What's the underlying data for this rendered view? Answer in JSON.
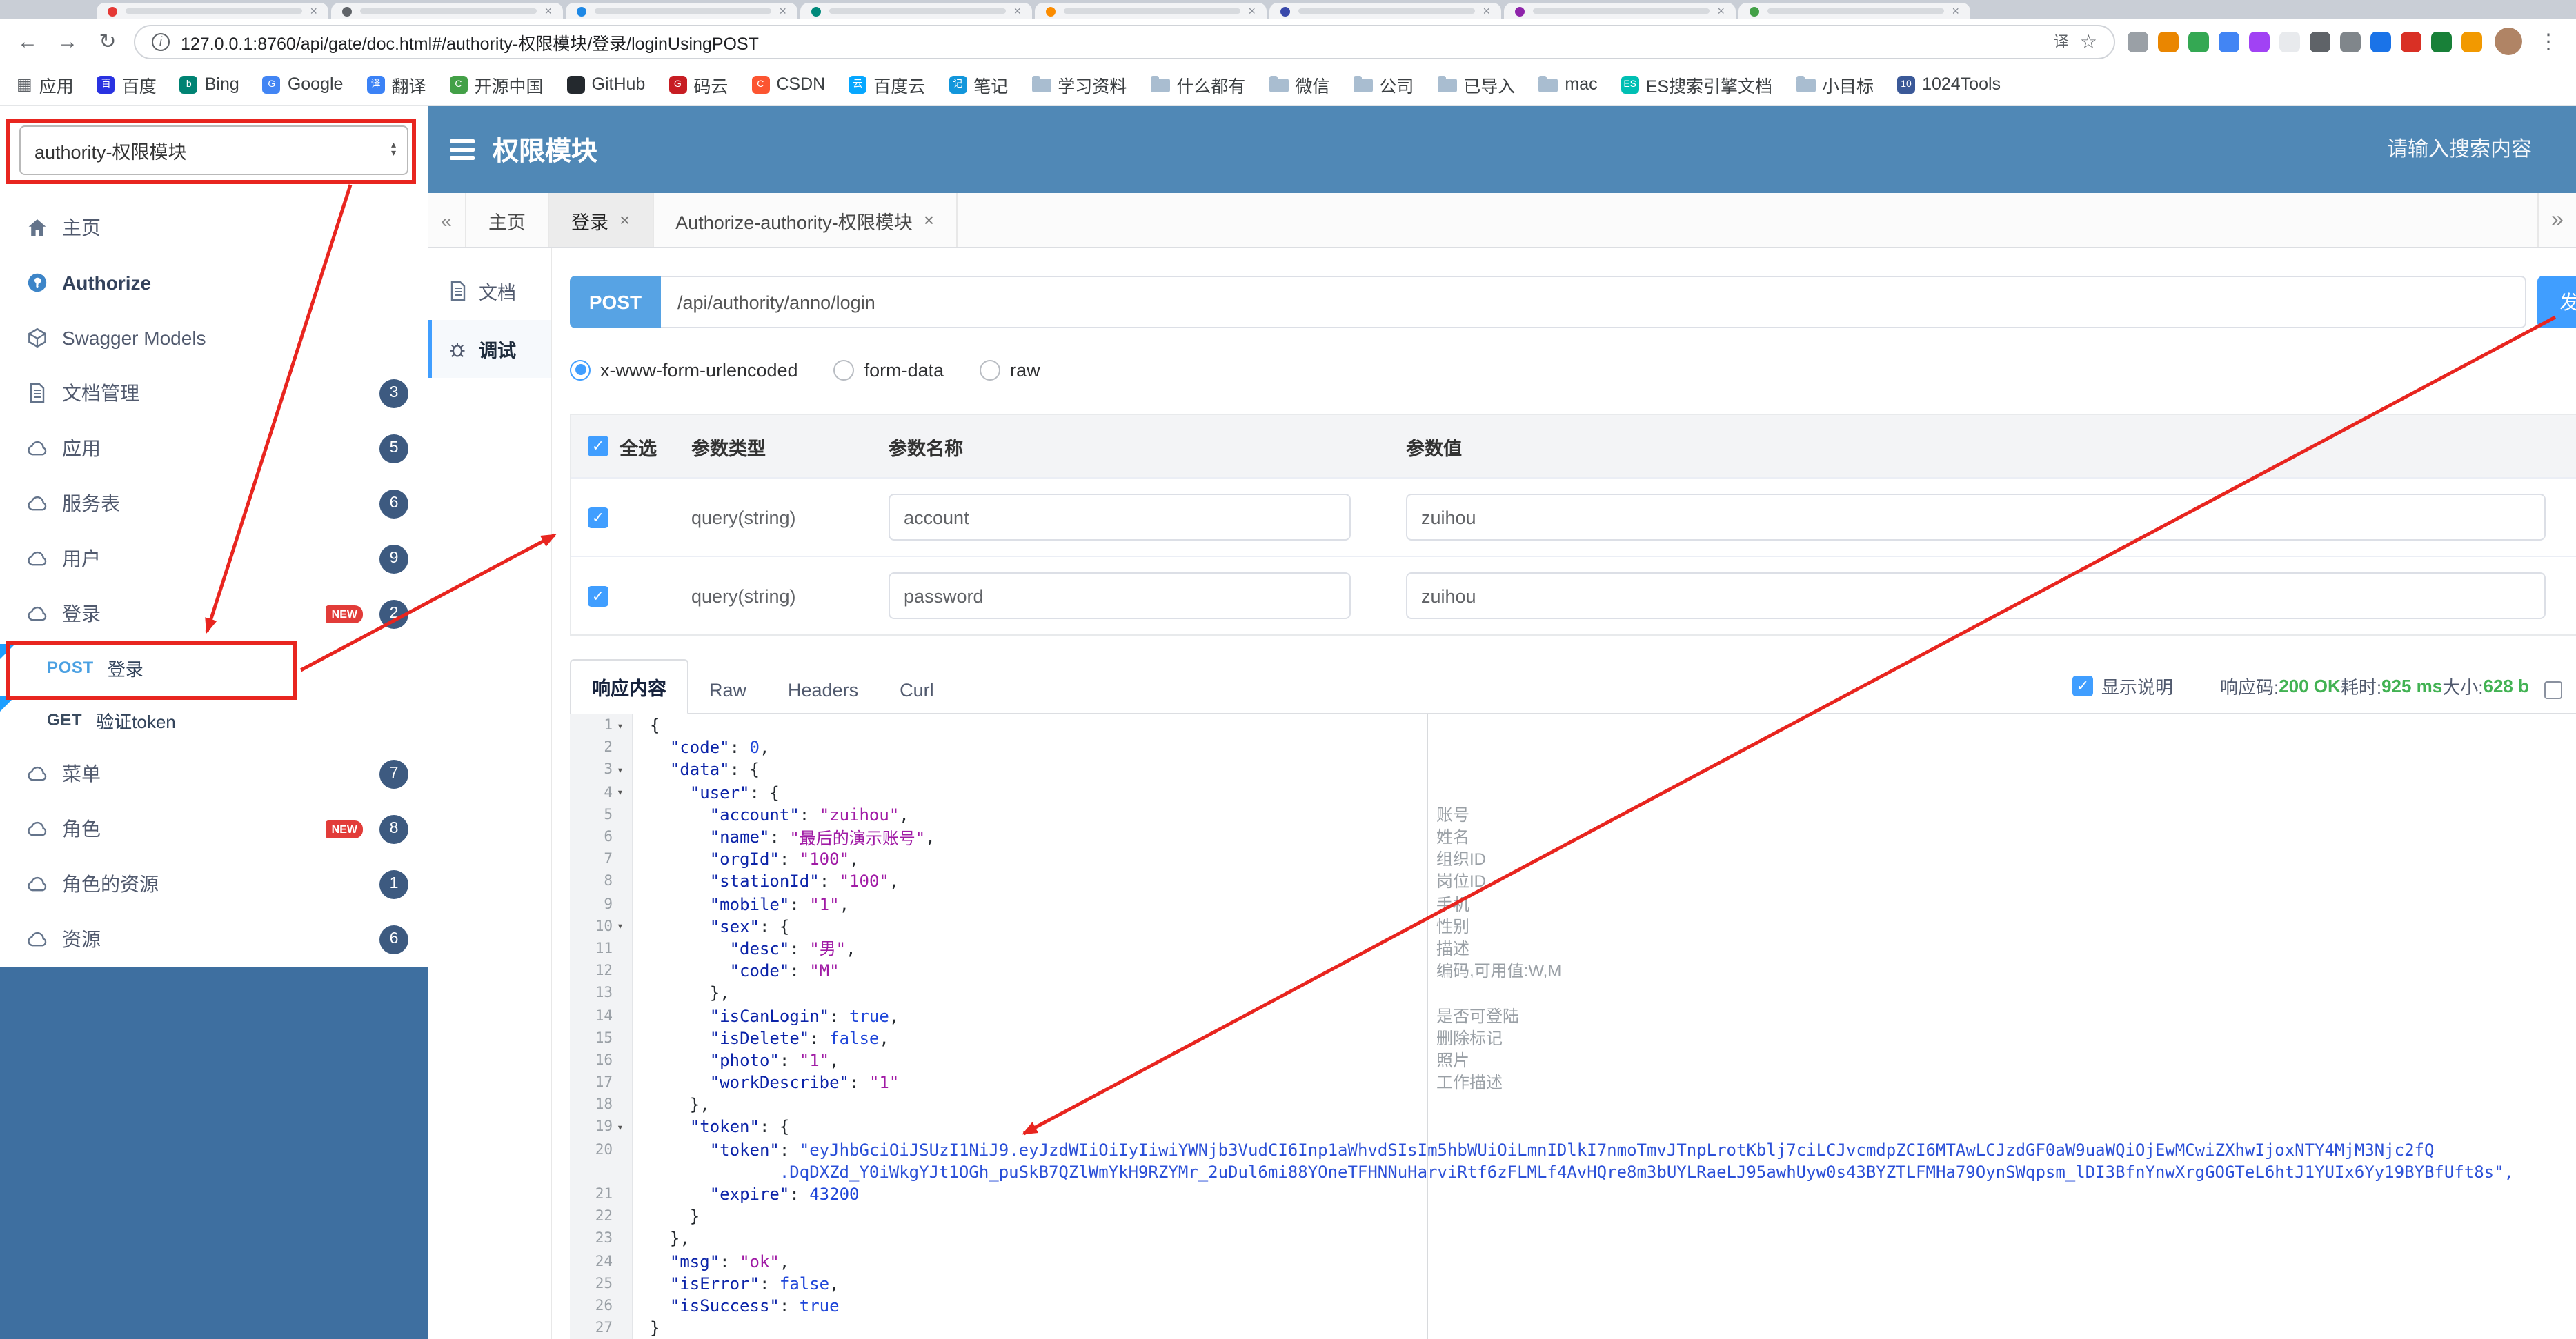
{
  "colors": {
    "accent_red": "#e8251f",
    "header_blue": "#5088b6",
    "primary_blue": "#409eff",
    "method_blue": "#57a3e4",
    "badge_navy": "#3d5a80",
    "success_green": "#42b253"
  },
  "browser": {
    "url": "127.0.0.1:8760/api/gate/doc.html#/authority-权限模块/登录/loginUsingPOST",
    "tab_strip": {
      "favicons": [
        "#e53935",
        "#5f6368",
        "#1e88e5",
        "#00897b",
        "#fb8c00",
        "#3949ab",
        "#8e24aa",
        "#43a047"
      ]
    },
    "extensions": [
      "#9aa0a6",
      "#ea8600",
      "#34a853",
      "#4285f4",
      "#a142f4",
      "#e8eaed",
      "#5f6368",
      "#80868b",
      "#1a73e8",
      "#d93025",
      "#188038",
      "#f29900"
    ],
    "bookmarks": [
      {
        "label": "应用",
        "icon": "grid"
      },
      {
        "label": "百度",
        "icon": "dot",
        "color": "#2932e1",
        "glyph": "百"
      },
      {
        "label": "Bing",
        "icon": "dot",
        "color": "#008373",
        "glyph": "b"
      },
      {
        "label": "Google",
        "icon": "dot",
        "color": "#4285f4",
        "glyph": "G"
      },
      {
        "label": "翻译",
        "icon": "dot",
        "color": "#3b82f6",
        "glyph": "译"
      },
      {
        "label": "开源中国",
        "icon": "dot",
        "color": "#43a047",
        "glyph": "C"
      },
      {
        "label": "GitHub",
        "icon": "dot",
        "color": "#24292e",
        "glyph": ""
      },
      {
        "label": "码云",
        "icon": "dot",
        "color": "#c71d23",
        "glyph": "G"
      },
      {
        "label": "CSDN",
        "icon": "dot",
        "color": "#fc5531",
        "glyph": "C"
      },
      {
        "label": "百度云",
        "icon": "dot",
        "color": "#06a7ff",
        "glyph": "云"
      },
      {
        "label": "笔记",
        "icon": "dot",
        "color": "#1296db",
        "glyph": "记"
      },
      {
        "label": "学习资料",
        "icon": "folder"
      },
      {
        "label": "什么都有",
        "icon": "folder"
      },
      {
        "label": "微信",
        "icon": "folder"
      },
      {
        "label": "公司",
        "icon": "folder"
      },
      {
        "label": "已导入",
        "icon": "folder"
      },
      {
        "label": "mac",
        "icon": "folder"
      },
      {
        "label": "ES搜索引擎文档",
        "icon": "dot",
        "color": "#00bfb3",
        "glyph": "ES"
      },
      {
        "label": "小目标",
        "icon": "folder"
      },
      {
        "label": "1024Tools",
        "icon": "dot",
        "color": "#3b5998",
        "glyph": "10"
      }
    ]
  },
  "header": {
    "group_select": "authority-权限模块",
    "title": "权限模块",
    "search_placeholder": "请输入搜索内容"
  },
  "sidebar": {
    "items": [
      {
        "label": "主页",
        "icon": "home"
      },
      {
        "label": "Authorize",
        "icon": "auth",
        "bold": true
      },
      {
        "label": "Swagger Models",
        "icon": "models"
      },
      {
        "label": "文档管理",
        "icon": "doc",
        "badge": "3"
      },
      {
        "label": "应用",
        "icon": "cloud",
        "badge": "5"
      },
      {
        "label": "服务表",
        "icon": "cloud",
        "badge": "6"
      },
      {
        "label": "用户",
        "icon": "cloud",
        "badge": "9"
      },
      {
        "label": "登录",
        "icon": "cloud",
        "badge": "2",
        "new": true,
        "children": [
          {
            "method": "POST",
            "label": "登录"
          },
          {
            "method": "GET",
            "label": "验证token"
          }
        ]
      },
      {
        "label": "菜单",
        "icon": "cloud",
        "badge": "7"
      },
      {
        "label": "角色",
        "icon": "cloud",
        "badge": "8",
        "new": true
      },
      {
        "label": "角色的资源",
        "icon": "cloud",
        "badge": "1"
      },
      {
        "label": "资源",
        "icon": "cloud",
        "badge": "6"
      }
    ]
  },
  "tabs": {
    "items": [
      {
        "label": "主页",
        "closable": false,
        "active": false
      },
      {
        "label": "登录",
        "closable": true,
        "active": true
      },
      {
        "label": "Authorize-authority-权限模块",
        "closable": true,
        "active": false
      }
    ]
  },
  "doc_nav": {
    "items": [
      {
        "label": "文档",
        "icon": "doc",
        "active": false
      },
      {
        "label": "调试",
        "icon": "debug",
        "active": true
      }
    ]
  },
  "request": {
    "method": "POST",
    "path": "/api/authority/anno/login",
    "send_label": "发送",
    "content_types": [
      {
        "label": "x-www-form-urlencoded",
        "selected": true
      },
      {
        "label": "form-data",
        "selected": false
      },
      {
        "label": "raw",
        "selected": false
      }
    ],
    "table": {
      "headers": [
        "全选",
        "参数类型",
        "参数名称",
        "参数值"
      ],
      "rows": [
        {
          "checked": true,
          "type": "query(string)",
          "name": "account",
          "value": "zuihou"
        },
        {
          "checked": true,
          "type": "query(string)",
          "name": "password",
          "value": "zuihou"
        }
      ]
    }
  },
  "response": {
    "tabs": [
      "响应内容",
      "Raw",
      "Headers",
      "Curl"
    ],
    "active_tab": "响应内容",
    "show_desc_label": "显示说明",
    "status_label": "响应码:",
    "status_value": "200 OK",
    "time_label": "耗时:",
    "time_value": "925 ms",
    "size_label": "大小:",
    "size_value": "628 b"
  },
  "editor": {
    "lines": [
      {
        "n": "1",
        "fold": true,
        "seg": [
          [
            "p",
            "{"
          ]
        ]
      },
      {
        "n": "2",
        "seg": [
          [
            "p",
            "  "
          ],
          [
            "k",
            "\"code\""
          ],
          [
            "p",
            ": "
          ],
          [
            "d",
            "0"
          ],
          [
            "p",
            ","
          ]
        ]
      },
      {
        "n": "3",
        "fold": true,
        "seg": [
          [
            "p",
            "  "
          ],
          [
            "k",
            "\"data\""
          ],
          [
            "p",
            ": {"
          ]
        ]
      },
      {
        "n": "4",
        "fold": true,
        "seg": [
          [
            "p",
            "    "
          ],
          [
            "k",
            "\"user\""
          ],
          [
            "p",
            ": {"
          ]
        ]
      },
      {
        "n": "5",
        "seg": [
          [
            "p",
            "      "
          ],
          [
            "k",
            "\"account\""
          ],
          [
            "p",
            ": "
          ],
          [
            "s",
            "\"zuihou\""
          ],
          [
            "p",
            ","
          ]
        ]
      },
      {
        "n": "6",
        "seg": [
          [
            "p",
            "      "
          ],
          [
            "k",
            "\"name\""
          ],
          [
            "p",
            ": "
          ],
          [
            "s",
            "\"最后的演示账号\""
          ],
          [
            "p",
            ","
          ]
        ]
      },
      {
        "n": "7",
        "seg": [
          [
            "p",
            "      "
          ],
          [
            "k",
            "\"orgId\""
          ],
          [
            "p",
            ": "
          ],
          [
            "s",
            "\"100\""
          ],
          [
            "p",
            ","
          ]
        ]
      },
      {
        "n": "8",
        "seg": [
          [
            "p",
            "      "
          ],
          [
            "k",
            "\"stationId\""
          ],
          [
            "p",
            ": "
          ],
          [
            "s",
            "\"100\""
          ],
          [
            "p",
            ","
          ]
        ]
      },
      {
        "n": "9",
        "seg": [
          [
            "p",
            "      "
          ],
          [
            "k",
            "\"mobile\""
          ],
          [
            "p",
            ": "
          ],
          [
            "s",
            "\"1\""
          ],
          [
            "p",
            ","
          ]
        ]
      },
      {
        "n": "10",
        "fold": true,
        "seg": [
          [
            "p",
            "      "
          ],
          [
            "k",
            "\"sex\""
          ],
          [
            "p",
            ": {"
          ]
        ]
      },
      {
        "n": "11",
        "seg": [
          [
            "p",
            "        "
          ],
          [
            "k",
            "\"desc\""
          ],
          [
            "p",
            ": "
          ],
          [
            "s",
            "\"男\""
          ],
          [
            "p",
            ","
          ]
        ]
      },
      {
        "n": "12",
        "seg": [
          [
            "p",
            "        "
          ],
          [
            "k",
            "\"code\""
          ],
          [
            "p",
            ": "
          ],
          [
            "s",
            "\"M\""
          ]
        ]
      },
      {
        "n": "13",
        "seg": [
          [
            "p",
            "      },"
          ]
        ]
      },
      {
        "n": "14",
        "seg": [
          [
            "p",
            "      "
          ],
          [
            "k",
            "\"isCanLogin\""
          ],
          [
            "p",
            ": "
          ],
          [
            "b",
            "true"
          ],
          [
            "p",
            ","
          ]
        ]
      },
      {
        "n": "15",
        "seg": [
          [
            "p",
            "      "
          ],
          [
            "k",
            "\"isDelete\""
          ],
          [
            "p",
            ": "
          ],
          [
            "b",
            "false"
          ],
          [
            "p",
            ","
          ]
        ]
      },
      {
        "n": "16",
        "seg": [
          [
            "p",
            "      "
          ],
          [
            "k",
            "\"photo\""
          ],
          [
            "p",
            ": "
          ],
          [
            "s",
            "\"1\""
          ],
          [
            "p",
            ","
          ]
        ]
      },
      {
        "n": "17",
        "seg": [
          [
            "p",
            "      "
          ],
          [
            "k",
            "\"workDescribe\""
          ],
          [
            "p",
            ": "
          ],
          [
            "s",
            "\"1\""
          ]
        ]
      },
      {
        "n": "18",
        "seg": [
          [
            "p",
            "    },"
          ]
        ]
      },
      {
        "n": "19",
        "fold": true,
        "seg": [
          [
            "p",
            "    "
          ],
          [
            "k",
            "\"token\""
          ],
          [
            "p",
            ": {"
          ]
        ]
      },
      {
        "n": "20",
        "seg": [
          [
            "p",
            "      "
          ],
          [
            "k",
            "\"token\""
          ],
          [
            "p",
            ": "
          ],
          [
            "t",
            "\"eyJhbGciOiJSUzI1NiJ9.eyJzdWIiOiIyIiwiYWNjb3VudCI6Inp1aWhvdSIsIm5hbWUiOiLmnIDlkI7nmoTmvJTnpLrotKblj7ciLCJvcmdpZCI6MTAwLCJzdGF0aW9uaWQiOjEwMCwiZXhwIjoxNTY4MjM3Njc2fQ"
          ]
        ]
      },
      {
        "n": "",
        "seg": [
          [
            "p",
            "             "
          ],
          [
            "t",
            ".DqDXZd_Y0iWkgYJt1OGh_puSkB7QZlWmYkH9RZYMr_2uDul6mi88YOneTFHNNuHarviRtf6zFLMLf4AvHQre8m3bUYLRaeLJ95awhUyw0s43BYZTLFMHa79OynSWqpsm_lDI3BfnYnwXrgGOGTeL6htJ1YUIx6Yy19BYBfUft8s\","
          ]
        ]
      },
      {
        "n": "21",
        "seg": [
          [
            "p",
            "      "
          ],
          [
            "k",
            "\"expire\""
          ],
          [
            "p",
            ": "
          ],
          [
            "d",
            "43200"
          ]
        ]
      },
      {
        "n": "22",
        "seg": [
          [
            "p",
            "    }"
          ]
        ]
      },
      {
        "n": "23",
        "seg": [
          [
            "p",
            "  },"
          ]
        ]
      },
      {
        "n": "24",
        "seg": [
          [
            "p",
            "  "
          ],
          [
            "k",
            "\"msg\""
          ],
          [
            "p",
            ": "
          ],
          [
            "s",
            "\"ok\""
          ],
          [
            "p",
            ","
          ]
        ]
      },
      {
        "n": "25",
        "seg": [
          [
            "p",
            "  "
          ],
          [
            "k",
            "\"isError\""
          ],
          [
            "p",
            ": "
          ],
          [
            "b",
            "false"
          ],
          [
            "p",
            ","
          ]
        ]
      },
      {
        "n": "26",
        "seg": [
          [
            "p",
            "  "
          ],
          [
            "k",
            "\"isSuccess\""
          ],
          [
            "p",
            ": "
          ],
          [
            "b",
            "true"
          ]
        ]
      },
      {
        "n": "27",
        "seg": [
          [
            "p",
            "}"
          ]
        ]
      }
    ],
    "annotations": [
      {
        "line": 5,
        "text": "账号"
      },
      {
        "line": 6,
        "text": "姓名"
      },
      {
        "line": 7,
        "text": "组织ID"
      },
      {
        "line": 8,
        "text": "岗位ID"
      },
      {
        "line": 9,
        "text": "手机"
      },
      {
        "line": 10,
        "text": "性别"
      },
      {
        "line": 11,
        "text": "描述"
      },
      {
        "line": 12,
        "text": "编码,可用值:W,M"
      },
      {
        "line": 14,
        "text": "是否可登陆"
      },
      {
        "line": 15,
        "text": "删除标记"
      },
      {
        "line": 16,
        "text": "照片"
      },
      {
        "line": 17,
        "text": "工作描述"
      }
    ]
  }
}
